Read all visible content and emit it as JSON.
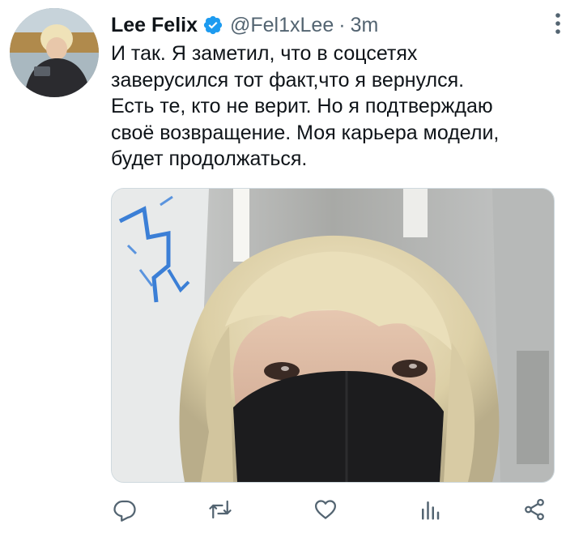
{
  "author": {
    "name": "Lee Felix",
    "verified_icon": "verified-badge-icon",
    "handle": "@Fel1xLee",
    "separator": "·",
    "time": "3m"
  },
  "tweet": {
    "text": "И так. Я заметил, что в соцсетях\nзаверусился тот факт,что я вернулся.\nЕсть те, кто не верит. Но я подтверждаю\nсвоё возвращение. Моя карьера модели,\nбудет продолжаться."
  },
  "actions": [
    {
      "name": "reply",
      "icon": "reply-icon"
    },
    {
      "name": "retweet",
      "icon": "retweet-icon"
    },
    {
      "name": "like",
      "icon": "heart-icon"
    },
    {
      "name": "analytics",
      "icon": "analytics-icon"
    },
    {
      "name": "share",
      "icon": "share-icon"
    }
  ],
  "colors": {
    "text": "#0f1419",
    "secondary": "#536471",
    "verified": "#1d9bf0",
    "icon": "#536471"
  }
}
